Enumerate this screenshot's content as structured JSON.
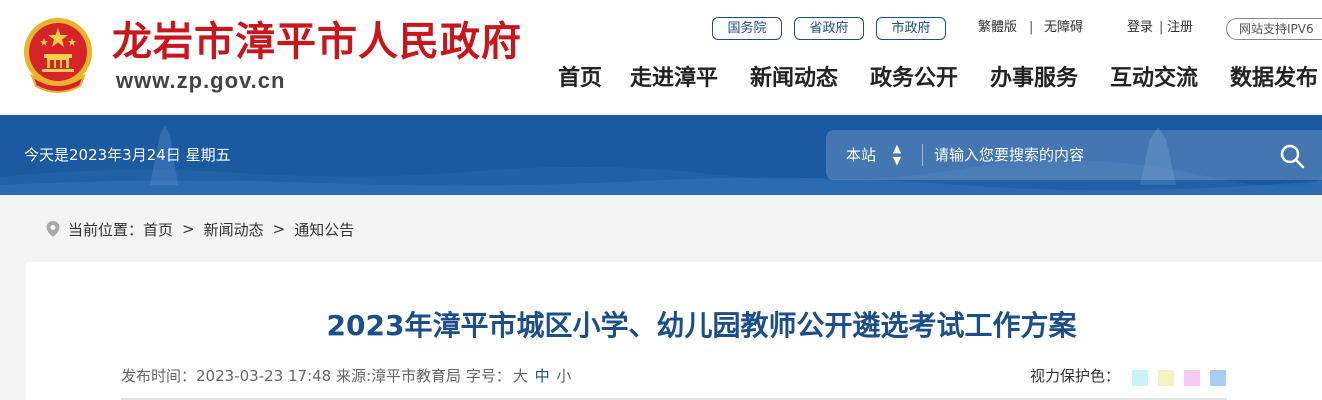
{
  "header": {
    "site_name": "龙岩市漳平市人民政府",
    "site_url": "www.zp.gov.cn",
    "gov_links": [
      "国务院",
      "省政府",
      "市政府"
    ],
    "traditional": "繁體版",
    "accessible": "无障碍",
    "login": "登录",
    "register": "注册",
    "ipv6": "网站支持IPV6",
    "nav": [
      "首页",
      "走进漳平",
      "新闻动态",
      "政务公开",
      "办事服务",
      "互动交流",
      "数据发布"
    ]
  },
  "banner": {
    "date_text": "今天是2023年3月24日 星期五",
    "search_scope": "本站",
    "search_placeholder": "请输入您要搜索的内容"
  },
  "breadcrumb": {
    "label": "当前位置：",
    "items": [
      "首页",
      "新闻动态",
      "通知公告"
    ],
    "separator": ">"
  },
  "article": {
    "title": "2023年漳平市城区小学、幼儿园教师公开遴选考试工作方案",
    "publish_label": "发布时间：",
    "publish_time": "2023-03-23 17:48",
    "source": "来源:漳平市教育局",
    "font_size_label": "字号：",
    "font_sizes": [
      "大",
      "中",
      "小"
    ],
    "eye_protect_label": "视力保护色：",
    "eye_colors": [
      "#c9f3f7",
      "#f4f2c4",
      "#f7c9f1",
      "#a9cdf2"
    ]
  },
  "colors": {
    "brand_red": "#c8161d",
    "brand_blue": "#1c4f89",
    "banner_blue": "#1b5aa0"
  }
}
